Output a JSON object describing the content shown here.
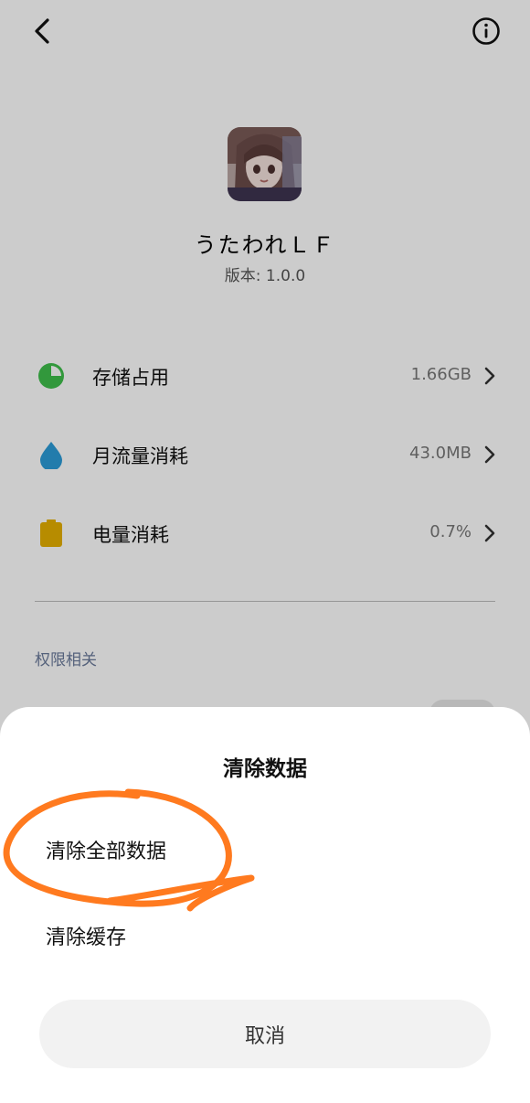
{
  "app": {
    "name": "うたわれＬＦ",
    "version": "版本: 1.0.0"
  },
  "stats": [
    {
      "label": "存储占用",
      "value": "1.66GB",
      "icon": "storage-pie-icon",
      "color": "#3fbf4b"
    },
    {
      "label": "月流量消耗",
      "value": "43.0MB",
      "icon": "data-drop-icon",
      "color": "#2b9cd8"
    },
    {
      "label": "电量消耗",
      "value": "0.7%",
      "icon": "battery-icon",
      "color": "#e5b000"
    }
  ],
  "section": {
    "permissions_title": "权限相关"
  },
  "sheet": {
    "title": "清除数据",
    "options": [
      "清除全部数据",
      "清除缓存"
    ],
    "cancel_label": "取消"
  },
  "colors": {
    "annotation": "#ff7a1f",
    "section_title": "#6a7a9a"
  }
}
